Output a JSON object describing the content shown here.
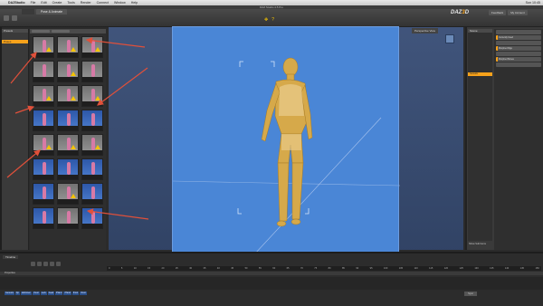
{
  "menubar": {
    "app": "DAZStudio",
    "items": [
      "File",
      "Edit",
      "Create",
      "Tools",
      "Render",
      "Connect",
      "Window",
      "Help"
    ],
    "clock": "Sun 10:45"
  },
  "window_title": "DAZ Studio 4.5 Pro",
  "tabs": {
    "inactive": "",
    "active": "Pose & Animate"
  },
  "logo": {
    "left": "DAZ",
    "mid": "3",
    "right": "D"
  },
  "top_buttons": [
    "Feedback",
    "My Account"
  ],
  "library": {
    "header": "Presets",
    "items": [
      "",
      "",
      "Poses"
    ]
  },
  "viewport": {
    "camera": "Perspective View"
  },
  "scene": {
    "header": "Scene",
    "rows": [
      "",
      "",
      "",
      "",
      "",
      "",
      "",
      "",
      "",
      "",
      "",
      "Genesis",
      "",
      ""
    ],
    "selected_index": 11
  },
  "params": {
    "rows": [
      "",
      "Currently Used",
      "",
      "Morphed Rigs",
      "",
      "Morphed Bones",
      ""
    ]
  },
  "show_sub": "Show Sub Items",
  "timeline": {
    "title": "Timeline",
    "ruler": [
      "0",
      "5",
      "10",
      "15",
      "20",
      "25",
      "30",
      "35",
      "40",
      "45",
      "50",
      "55",
      "60",
      "65",
      "70",
      "75",
      "80",
      "85",
      "90",
      "95",
      "100",
      "105",
      "110",
      "115",
      "120",
      "125",
      "130",
      "135",
      "140",
      "145",
      "150"
    ],
    "prop_label": "Properties",
    "tags": [
      "Genesis",
      "hip",
      "abdomen",
      "chest",
      "neck",
      "head",
      "lHand",
      "rHand",
      "lFoot",
      "rFoot"
    ],
    "end_btn": "Sync"
  },
  "colors": {
    "accent": "#f7a21b",
    "viewport": "#4a86d6",
    "warn": "#f5c400",
    "arrow": "#e0503a"
  },
  "icons": [
    "apple-icon",
    "warning-icon",
    "cube-gizmo-icon"
  ]
}
